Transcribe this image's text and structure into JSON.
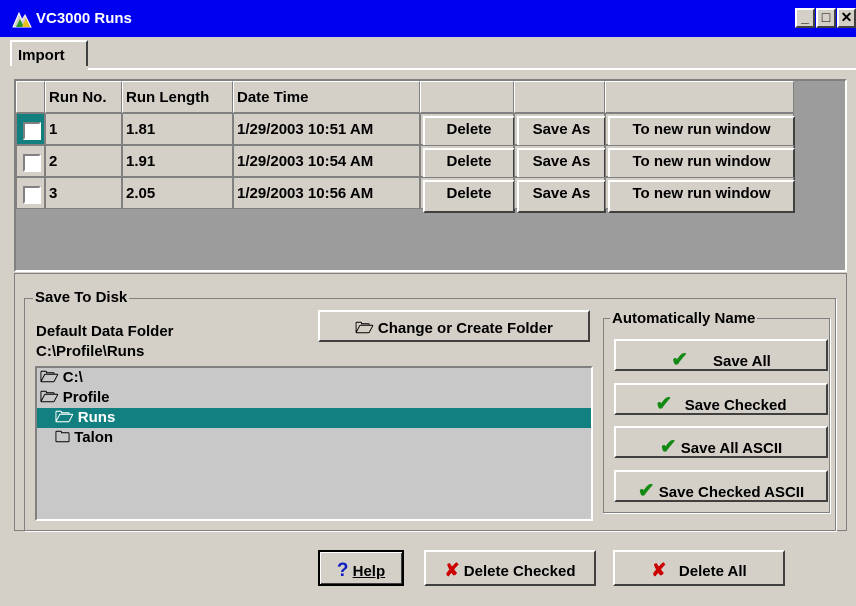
{
  "window": {
    "title": "VC3000 Runs",
    "controls": {
      "minimize": "_",
      "maximize": "□",
      "close": "✕"
    }
  },
  "tabs": [
    {
      "label": "Import",
      "active": true
    }
  ],
  "grid": {
    "columns": [
      "Run No.",
      "Run Length",
      "Date Time"
    ],
    "rows": [
      {
        "checked": false,
        "run_no": "1",
        "run_length": "1.81",
        "date_time": "1/29/2003 10:51 AM",
        "delete": "Delete",
        "save_as": "Save As",
        "new_window": "To new run window"
      },
      {
        "checked": false,
        "run_no": "2",
        "run_length": "1.91",
        "date_time": "1/29/2003 10:54 AM",
        "delete": "Delete",
        "save_as": "Save As",
        "new_window": "To new run window"
      },
      {
        "checked": false,
        "run_no": "3",
        "run_length": "2.05",
        "date_time": "1/29/2003 10:56 AM",
        "delete": "Delete",
        "save_as": "Save As",
        "new_window": "To new run window"
      }
    ]
  },
  "save_to_disk": {
    "legend": "Save To Disk",
    "folder_label": "Default Data Folder",
    "folder_path": "C:\\Profile\\Runs",
    "change_folder_button": "Change or Create Folder",
    "tree": [
      {
        "label": "C:\\",
        "icon": "open-folder",
        "level": 0,
        "selected": false
      },
      {
        "label": "Profile",
        "icon": "open-folder",
        "level": 0,
        "selected": false
      },
      {
        "label": "Runs",
        "icon": "open-folder",
        "level": 1,
        "selected": true
      },
      {
        "label": "Talon",
        "icon": "closed-folder",
        "level": 1,
        "selected": false
      }
    ],
    "selection_color": "#128080"
  },
  "auto_name": {
    "legend": "Automatically Name",
    "buttons": [
      "Save All",
      "Save Checked",
      "Save All ASCII",
      "Save Checked ASCII"
    ]
  },
  "footer": {
    "help": "Help",
    "delete_checked": "Delete Checked",
    "delete_all": "Delete All"
  },
  "colors": {
    "title_bar": "#0000f0",
    "face": "#d4d0c8",
    "grid_background": "#9c9c9c",
    "check": "#138a13",
    "delete_x": "#cc0000"
  }
}
